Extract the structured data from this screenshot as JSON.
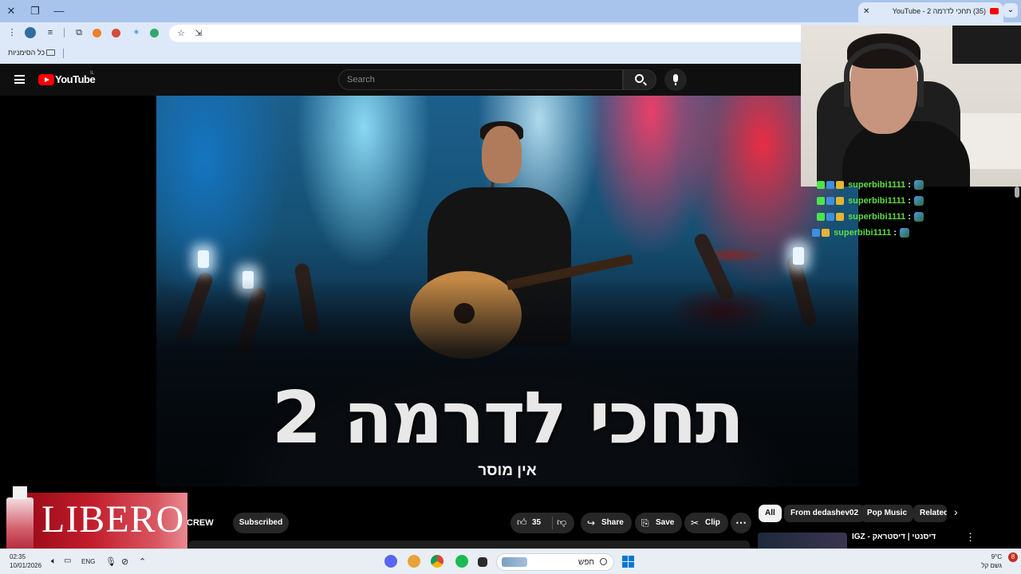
{
  "browser": {
    "tab_title": "(35) תחכי לדרמה 2 - YouTube",
    "bookmark_label": "כל הסימניות"
  },
  "youtube": {
    "logo_text": "YouTube",
    "country_code": "IL",
    "search_placeholder": "Search"
  },
  "video": {
    "title_overlay": "תחכי לדרמה 2",
    "subtitle_overlay": "אין מוסר"
  },
  "chat": {
    "lines": [
      {
        "user": "superbibi1111",
        "sep": ":"
      },
      {
        "user": "superbibi1111",
        "sep": ":"
      },
      {
        "user": "superbibi1111",
        "sep": ":"
      },
      {
        "user": "superbibi1111",
        "sep": ":"
      }
    ]
  },
  "actions": {
    "channel_fragment": "CREW",
    "subscribed_label": "Subscribed",
    "like_count": "35",
    "share_label": "Share",
    "save_label": "Save",
    "clip_label": "Clip",
    "more_label": "⋯"
  },
  "chips": {
    "all": "All",
    "from": "From dedashev02",
    "pop": "Pop Music",
    "related": "Related"
  },
  "related_video": {
    "title": "IGZ - דיסנטי | דיסטראק"
  },
  "ad": {
    "brand": "LIBERO"
  },
  "taskbar": {
    "time": "02:35",
    "date": "10/01/2026",
    "language": "ENG",
    "search_label": "חפש",
    "temperature": "9°C",
    "weather_text": "גשם קל",
    "notification_count": "8"
  }
}
